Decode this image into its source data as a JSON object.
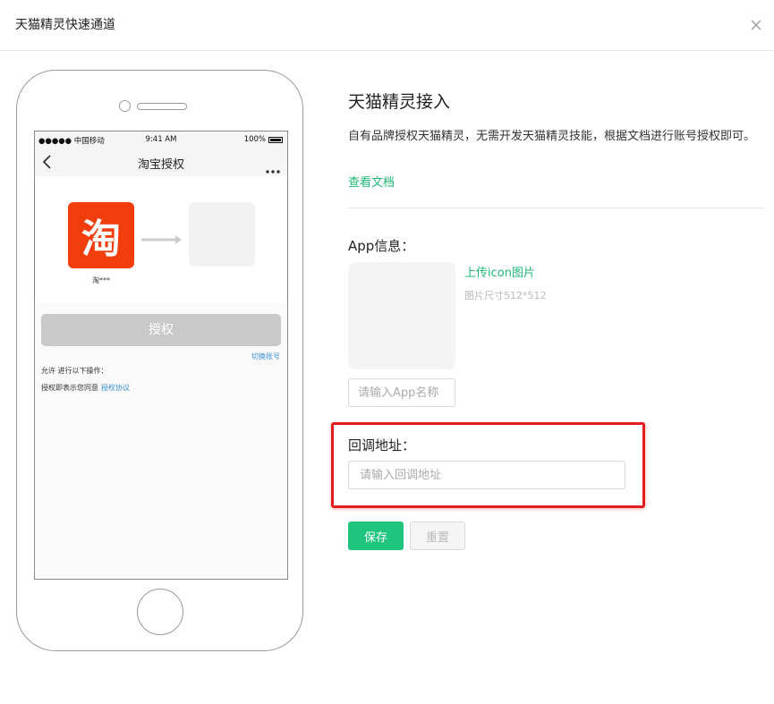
{
  "modal": {
    "title": "天猫精灵快速通道",
    "close_icon": "close-icon"
  },
  "phone": {
    "statusbar": {
      "carrier": "●●●●● 中国移动",
      "time": "9:41 AM",
      "battery": "100%"
    },
    "navbar": {
      "title": "淘宝授权"
    },
    "app_logo_char": "淘",
    "app_caption": "淘***",
    "auth_button": "授权",
    "switch_account": "切换账号",
    "permissions_text": "允许 进行以下操作：",
    "agree_prefix": "授权即表示您同意",
    "agree_link": "授权协议"
  },
  "panel": {
    "title": "天猫精灵接入",
    "description": "自有品牌授权天猫精灵，无需开发天猫精灵技能，根据文档进行账号授权即可。",
    "doc_link": "查看文档",
    "app_info_label": "App信息：",
    "upload_link": "上传icon图片",
    "icon_hint": "图片尺寸512*512",
    "app_name_placeholder": "请输入App名称",
    "callback_label": "回调地址：",
    "callback_placeholder": "请输入回调地址",
    "save_label": "保存",
    "reset_label": "重置"
  },
  "colors": {
    "accent": "#1fc47d",
    "link": "#1fb877",
    "highlight": "#e51c1c",
    "taobao": "#f23d0d"
  }
}
